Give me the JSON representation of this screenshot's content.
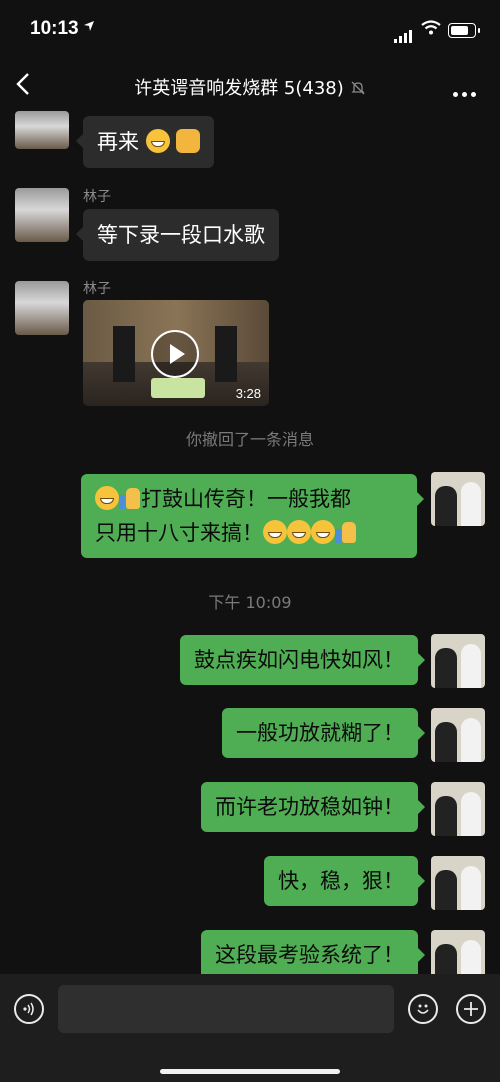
{
  "status_bar": {
    "time": "10:13"
  },
  "header": {
    "title": "许英谔音响发烧群 5(438)"
  },
  "messages": {
    "m1": {
      "text": "再来"
    },
    "m2": {
      "sender": "林子",
      "text": "等下录一段口水歌"
    },
    "m3": {
      "sender": "林子",
      "video_duration": "3:28"
    },
    "system_recall": "你撤回了一条消息",
    "m4": {
      "line1": "打鼓山传奇！一般我都",
      "line2": "只用十八寸来搞！"
    },
    "timestamp": "下午 10:09",
    "m5": {
      "text": "鼓点疾如闪电快如风！"
    },
    "m6": {
      "text": "一般功放就糊了！"
    },
    "m7": {
      "text": "而许老功放稳如钟！"
    },
    "m8": {
      "text": "快，稳，狠！"
    },
    "m9": {
      "text": "这段最考验系统了！"
    }
  },
  "colors": {
    "own_bubble": "#4fae54",
    "other_bubble": "#2c2c2c",
    "background": "#111111"
  },
  "icons": [
    "location-arrow-icon",
    "signal-icon",
    "wifi-icon",
    "battery-icon",
    "back-chevron-icon",
    "mute-bell-icon",
    "more-icon",
    "play-icon",
    "voice-icon",
    "emoji-icon",
    "plus-icon"
  ]
}
